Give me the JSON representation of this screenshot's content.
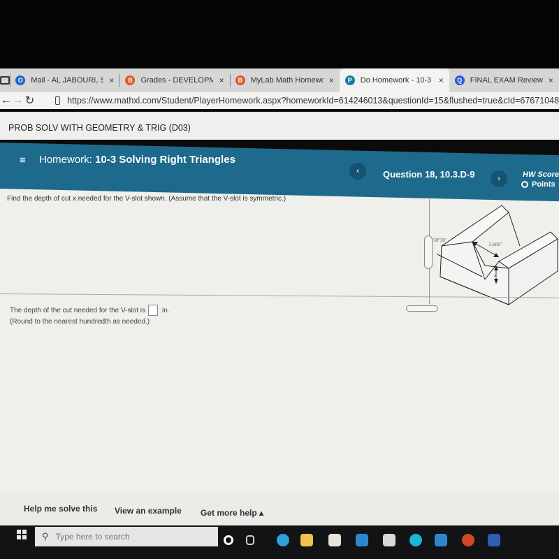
{
  "browser": {
    "tabs": [
      {
        "title": "Mail - AL JABOURI, SA",
        "icon": "outlook-icon",
        "color": "#1a66c6",
        "glyph": "O",
        "active": false
      },
      {
        "title": "Grades - DEVELOPME",
        "icon": "brightspace-icon",
        "color": "#e2572c",
        "glyph": "B",
        "active": false
      },
      {
        "title": "MyLab Math Homewo",
        "icon": "brightspace-icon",
        "color": "#e2572c",
        "glyph": "B",
        "active": false
      },
      {
        "title": "Do Homework - 10-3",
        "icon": "pearson-icon",
        "color": "#1a7da0",
        "glyph": "P",
        "active": true
      },
      {
        "title": "FINAL EXAM Review U",
        "icon": "quizlet-icon",
        "color": "#3058d8",
        "glyph": "Q",
        "active": false
      }
    ],
    "close_glyph": "×",
    "back_glyph": "←",
    "forward_glyph": "→",
    "reload_glyph": "↻",
    "url": "https://www.mathxl.com/Student/PlayerHomework.aspx?homeworkId=614246013&questionId=15&flushed=true&cId=67671048"
  },
  "course": {
    "title": "PROB SOLV WITH GEOMETRY & TRIG (D03)"
  },
  "header": {
    "menu_glyph": "≡",
    "homework_prefix": "Homework:",
    "homework_title": "10-3 Solving Right Triangles",
    "prev_glyph": "‹",
    "next_glyph": "›",
    "question_label": "Question 18, 10.3.D-9",
    "hw_score_label": "HW Score",
    "points_label": "Points"
  },
  "question": {
    "prompt": "Find the depth of cut x needed for the V-slot shown. (Assume that the V-slot is symmetric.)",
    "figure": {
      "angle_label": "58°30′",
      "width_label": "5.600\"",
      "unknown_label": "x"
    },
    "answer_prefix": "The depth of the cut needed for the V-slot is",
    "answer_value": "",
    "answer_unit": "in.",
    "round_note": "(Round to the nearest hundredth as needed.)"
  },
  "help": {
    "help_me_solve": "Help me solve this",
    "view_example": "View an example",
    "get_more_help": "Get more help ▴"
  },
  "taskbar": {
    "search_placeholder": "Type here to search",
    "search_glyph": "⚲",
    "apps": [
      {
        "name": "cortana-icon",
        "color": "#ffffff"
      },
      {
        "name": "task-view-icon",
        "color": "#cccccc"
      },
      {
        "name": "edge-icon",
        "color": "#2f9fd8"
      },
      {
        "name": "file-explorer-icon",
        "color": "#f2c14e"
      },
      {
        "name": "store-icon",
        "color": "#e8e2d8"
      },
      {
        "name": "mail-icon",
        "color": "#2f86d0"
      },
      {
        "name": "app-icon",
        "color": "#d8d8d8"
      },
      {
        "name": "alexa-icon",
        "color": "#1ab7d6"
      },
      {
        "name": "onedrive-icon",
        "color": "#2f86d0"
      },
      {
        "name": "powerpoint-icon",
        "color": "#d24726"
      },
      {
        "name": "word-icon",
        "color": "#2b5fb4"
      }
    ]
  }
}
